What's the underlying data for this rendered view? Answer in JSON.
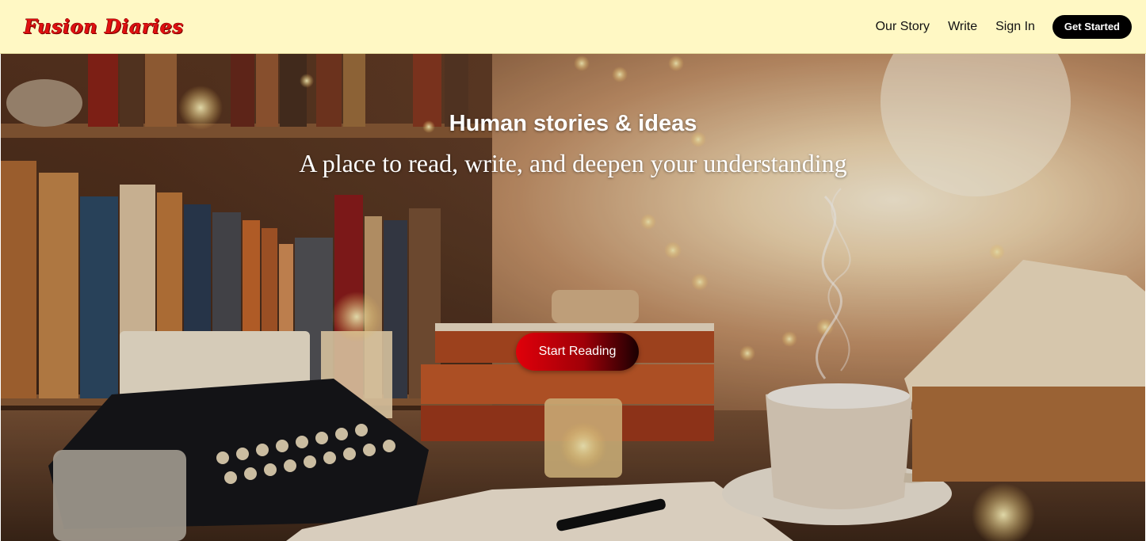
{
  "header": {
    "logo": "Fusion Diaries",
    "nav": [
      {
        "label": "Our Story"
      },
      {
        "label": "Write"
      },
      {
        "label": "Sign In"
      }
    ],
    "cta_label": "Get Started"
  },
  "hero": {
    "title": "Human stories & ideas",
    "subtitle": "A place to read, write, and deepen your understanding",
    "button_label": "Start Reading",
    "image": "cozy-reading-desk-illustration"
  },
  "colors": {
    "header_bg": "#fff8c4",
    "logo": "#e01010",
    "cta_bg": "#000000",
    "button_start": "#e0000a",
    "button_end": "#1a0002"
  }
}
